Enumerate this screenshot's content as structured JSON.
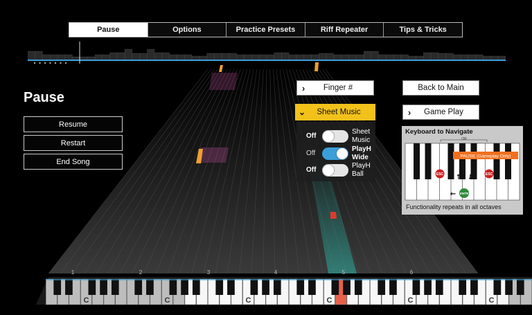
{
  "tabs": [
    {
      "label": "Pause",
      "active": true
    },
    {
      "label": "Options",
      "active": false
    },
    {
      "label": "Practice Presets",
      "active": false
    },
    {
      "label": "Riff Repeater",
      "active": false
    },
    {
      "label": "Tips & Tricks",
      "active": false
    }
  ],
  "pause_menu": {
    "title": "Pause",
    "resume": "Resume",
    "restart": "Restart",
    "end_song": "End Song"
  },
  "options": {
    "finger_label": "Finger #",
    "sheet_music_label": "Sheet Music",
    "back_label": "Back to Main",
    "game_play_label": "Game Play",
    "chevron_right": "›",
    "chevron_down": "⌄"
  },
  "toggles": [
    {
      "state": "Off",
      "line1": "Sheet",
      "line2": "Music",
      "on": false,
      "bold": false
    },
    {
      "state": "Off",
      "line1": "PlayH",
      "line2": "Wide",
      "on": true,
      "bold": true
    },
    {
      "state": "Off",
      "line1": "PlayH",
      "line2": "Ball",
      "on": false,
      "bold": false
    }
  ],
  "keyboard_nav": {
    "title": "Keyboard to Navigate",
    "callout": "PAUSE (Gameplay Only)",
    "or_label": "OR",
    "esc_label": "ESC",
    "enter_label": "ENTR",
    "left_arrow": "←",
    "up_arrow": "↑",
    "down_arrow": "↓",
    "footer": "Functionality repeats in all octaves"
  },
  "piano": {
    "octave_numbers": [
      "1",
      "2",
      "3",
      "4",
      "5",
      "6"
    ],
    "c_label": "C",
    "highlighted_key_color": "#e8604a"
  },
  "colors": {
    "accent_yellow": "#f2c21b",
    "toggle_on": "#3a9fd8",
    "progress_line": "#3a9fd8",
    "note_orange": "#f0a030",
    "note_pink": "#cc55aa",
    "note_red": "#e03a2a"
  }
}
